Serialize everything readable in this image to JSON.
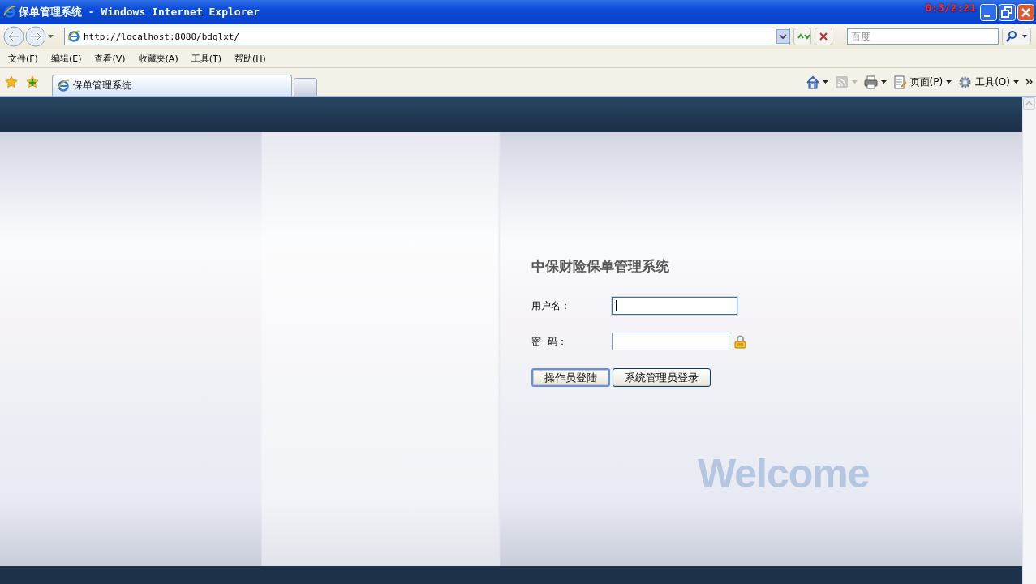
{
  "window": {
    "title": "保单管理系统 - Windows Internet Explorer",
    "timer": "0:3/2:21"
  },
  "address_bar": {
    "url": "http://localhost:8080/bdglxt/"
  },
  "search": {
    "placeholder": "百度"
  },
  "menu": [
    "文件(F)",
    "编辑(E)",
    "查看(V)",
    "收藏夹(A)",
    "工具(T)",
    "帮助(H)"
  ],
  "tabs": [
    {
      "label": "保单管理系统",
      "selected": true
    },
    {
      "selected": false
    }
  ],
  "command_bar": [
    {
      "kind": "home",
      "disabled": false
    },
    {
      "kind": "feeds",
      "disabled": true
    },
    {
      "kind": "print",
      "disabled": false
    },
    {
      "kind": "page",
      "label": "页面(P)",
      "disabled": false
    },
    {
      "kind": "tools",
      "label": "工具(O)",
      "disabled": false
    }
  ],
  "login": {
    "title": "中保财险保单管理系统",
    "fields": [
      {
        "label": "用户名：",
        "kind": "text",
        "focused": true
      },
      {
        "label": "密  码：",
        "kind": "password",
        "focused": false
      }
    ],
    "buttons": [
      {
        "label": "操作员登陆",
        "default": true
      },
      {
        "label": "系统管理员登录",
        "default": false
      }
    ]
  },
  "welcome": "Welcome"
}
